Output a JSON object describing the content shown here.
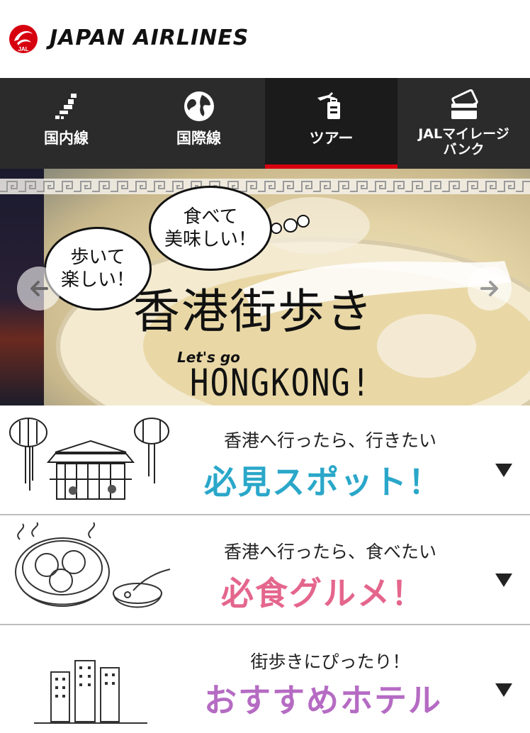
{
  "header": {
    "brand": "JAPAN AIRLINES",
    "logo_text": "JAL"
  },
  "nav": {
    "items": [
      {
        "label": "国内線",
        "icon": "japan-map-icon"
      },
      {
        "label": "国際線",
        "icon": "globe-icon"
      },
      {
        "label": "ツアー",
        "icon": "tour-luggage-icon",
        "active": true
      },
      {
        "label_line1": "JALマイレージ",
        "label_line2": "バンク",
        "icon": "card-icon"
      }
    ]
  },
  "hero": {
    "bubble_left_line1": "歩いて",
    "bubble_left_line2": "楽しい！",
    "bubble_right_line1": "食べて",
    "bubble_right_line2": "美味しい！",
    "title": "香港街歩き",
    "sub_script": "Let's go",
    "sub_main": "HONGKONG!"
  },
  "sections": [
    {
      "sub": "香港へ行ったら、行きたい",
      "title": "必見スポット！",
      "color": "#2aa7c9"
    },
    {
      "sub": "香港へ行ったら、食べたい",
      "title": "必食グルメ！",
      "color": "#e4668d"
    },
    {
      "sub": "街歩きにぴったり！",
      "title": "おすすめホテル",
      "color": "#b56bc3"
    }
  ],
  "colors": {
    "nav_bg": "#2b2b2b",
    "accent_red": "#d7000f"
  }
}
